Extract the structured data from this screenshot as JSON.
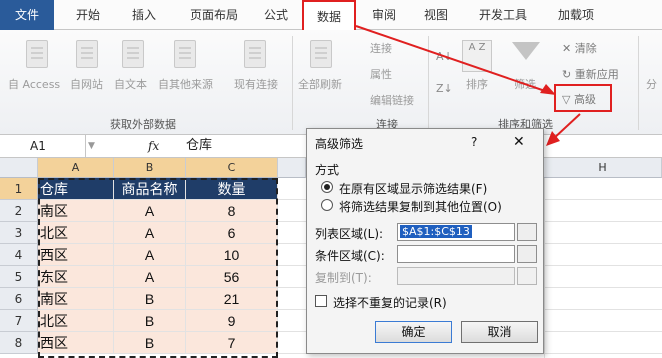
{
  "tabs": [
    "文件",
    "开始",
    "插入",
    "页面布局",
    "公式",
    "数据",
    "审阅",
    "视图",
    "开发工具",
    "加载项"
  ],
  "ribbon": {
    "external": [
      "自 Access",
      "自网站",
      "自文本",
      "自其他来源",
      "现有连接"
    ],
    "external_group": "获取外部数据",
    "refresh_all": "全部刷新",
    "connections": [
      "连接",
      "属性",
      "编辑链接"
    ],
    "connections_group": "连接",
    "sort_az": "A Z",
    "sort": "排序",
    "filter": "筛选",
    "clear": "清除",
    "reapply": "重新应用",
    "advanced": "高级",
    "sort_filter_group": "排序和筛选",
    "split": "分"
  },
  "formula_bar": {
    "name_box": "A1",
    "fx": "fx",
    "content": "仓库"
  },
  "grid": {
    "columns": [
      "A",
      "B",
      "C",
      "H"
    ],
    "rows": [
      "1",
      "2",
      "3",
      "4",
      "5",
      "6",
      "7",
      "8"
    ],
    "headers": [
      "仓库",
      "商品名称",
      "数量"
    ],
    "data": [
      [
        "南区",
        "A",
        "8"
      ],
      [
        "北区",
        "A",
        "6"
      ],
      [
        "西区",
        "A",
        "10"
      ],
      [
        "东区",
        "A",
        "56"
      ],
      [
        "南区",
        "B",
        "21"
      ],
      [
        "北区",
        "B",
        "9"
      ],
      [
        "西区",
        "B",
        "7"
      ]
    ]
  },
  "dialog": {
    "title": "高级筛选",
    "help": "?",
    "close": "✕",
    "method_label": "方式",
    "option1": "在原有区域显示筛选结果(F)",
    "option2": "将筛选结果复制到其他位置(O)",
    "list_range_label": "列表区域(L):",
    "list_range_value": "$A$1:$C$13",
    "criteria_label": "条件区域(C):",
    "copy_to_label": "复制到(T):",
    "unique_label": "选择不重复的记录(R)",
    "ok": "确定",
    "cancel": "取消"
  },
  "colors": {
    "accent_red": "#e02020",
    "file_tab": "#2a5b9a",
    "header_fill": "#1f3d68",
    "data_fill": "#fbe7dc"
  }
}
